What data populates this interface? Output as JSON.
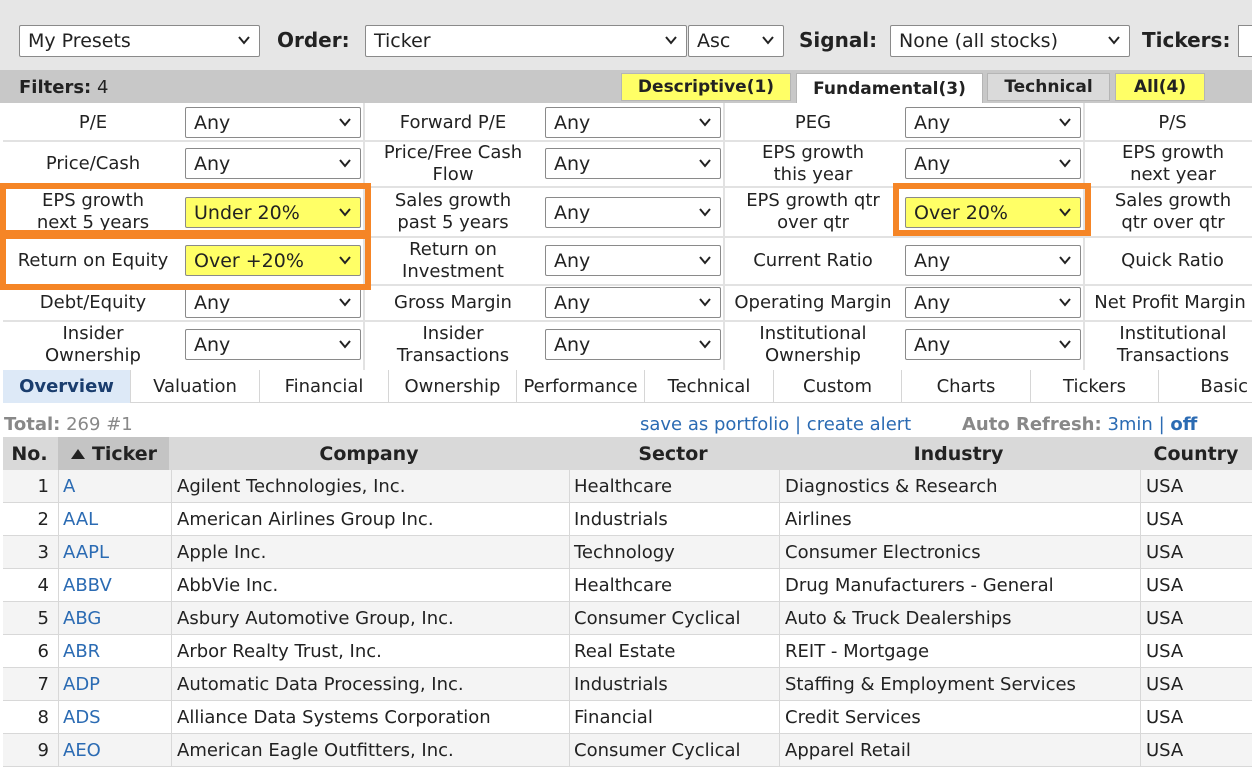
{
  "toolbar": {
    "presets": "My Presets",
    "order_label": "Order:",
    "order_value": "Ticker",
    "dir_value": "Asc",
    "signal_label": "Signal:",
    "signal_value": "None (all stocks)",
    "tickers_label": "Tickers:"
  },
  "filters_bar": {
    "label": "Filters:",
    "count": "4",
    "tabs": [
      "Descriptive(1)",
      "Fundamental(3)",
      "Technical",
      "All(4)"
    ]
  },
  "filters": [
    [
      {
        "label": "P/E",
        "value": "Any"
      },
      {
        "label": "Forward P/E",
        "value": "Any"
      },
      {
        "label": "PEG",
        "value": "Any"
      },
      {
        "label": "P/S"
      }
    ],
    [
      {
        "label": "Price/Cash",
        "value": "Any"
      },
      {
        "label": "Price/Free Cash Flow",
        "value": "Any"
      },
      {
        "label": "EPS growth this year",
        "value": "Any"
      },
      {
        "label": "EPS growth next year"
      }
    ],
    [
      {
        "label": "EPS growth next 5 years",
        "value": "Under 20%"
      },
      {
        "label": "Sales growth past 5 years",
        "value": "Any"
      },
      {
        "label": "EPS growth qtr over qtr",
        "value": "Over 20%"
      },
      {
        "label": "Sales growth qtr over qtr"
      }
    ],
    [
      {
        "label": "Return on Equity",
        "value": "Over +20%"
      },
      {
        "label": "Return on Investment",
        "value": "Any"
      },
      {
        "label": "Current Ratio",
        "value": "Any"
      },
      {
        "label": "Quick Ratio"
      }
    ],
    [
      {
        "label": "Debt/Equity",
        "value": "Any"
      },
      {
        "label": "Gross Margin",
        "value": "Any"
      },
      {
        "label": "Operating Margin",
        "value": "Any"
      },
      {
        "label": "Net Profit Margin"
      }
    ],
    [
      {
        "label": "Insider Ownership",
        "value": "Any"
      },
      {
        "label": "Insider Transactions",
        "value": "Any"
      },
      {
        "label": "Institutional Ownership",
        "value": "Any"
      },
      {
        "label": "Institutional Transactions"
      }
    ]
  ],
  "view_tabs": [
    "Overview",
    "Valuation",
    "Financial",
    "Ownership",
    "Performance",
    "Technical",
    "Custom",
    "Charts",
    "Tickers",
    "Basic"
  ],
  "summary": {
    "total_label": "Total:",
    "total_value": "269 #1",
    "save_portfolio": "save as portfolio",
    "separator": "|",
    "create_alert": "create alert",
    "auto_refresh_label": "Auto Refresh:",
    "auto_refresh_value": "3min",
    "auto_refresh_off": "off"
  },
  "table": {
    "headers": [
      "No.",
      "Ticker",
      "Company",
      "Sector",
      "Industry",
      "Country"
    ],
    "rows": [
      [
        "1",
        "A",
        "Agilent Technologies, Inc.",
        "Healthcare",
        "Diagnostics & Research",
        "USA"
      ],
      [
        "2",
        "AAL",
        "American Airlines Group Inc.",
        "Industrials",
        "Airlines",
        "USA"
      ],
      [
        "3",
        "AAPL",
        "Apple Inc.",
        "Technology",
        "Consumer Electronics",
        "USA"
      ],
      [
        "4",
        "ABBV",
        "AbbVie Inc.",
        "Healthcare",
        "Drug Manufacturers - General",
        "USA"
      ],
      [
        "5",
        "ABG",
        "Asbury Automotive Group, Inc.",
        "Consumer Cyclical",
        "Auto & Truck Dealerships",
        "USA"
      ],
      [
        "6",
        "ABR",
        "Arbor Realty Trust, Inc.",
        "Real Estate",
        "REIT - Mortgage",
        "USA"
      ],
      [
        "7",
        "ADP",
        "Automatic Data Processing, Inc.",
        "Industrials",
        "Staffing & Employment Services",
        "USA"
      ],
      [
        "8",
        "ADS",
        "Alliance Data Systems Corporation",
        "Financial",
        "Credit Services",
        "USA"
      ],
      [
        "9",
        "AEO",
        "American Eagle Outfitters, Inc.",
        "Consumer Cyclical",
        "Apparel Retail",
        "USA"
      ]
    ]
  },
  "colors": {
    "highlight_yellow": "#ffff66",
    "annotation_orange": "#f58526",
    "link_blue": "#2b6bb3"
  }
}
